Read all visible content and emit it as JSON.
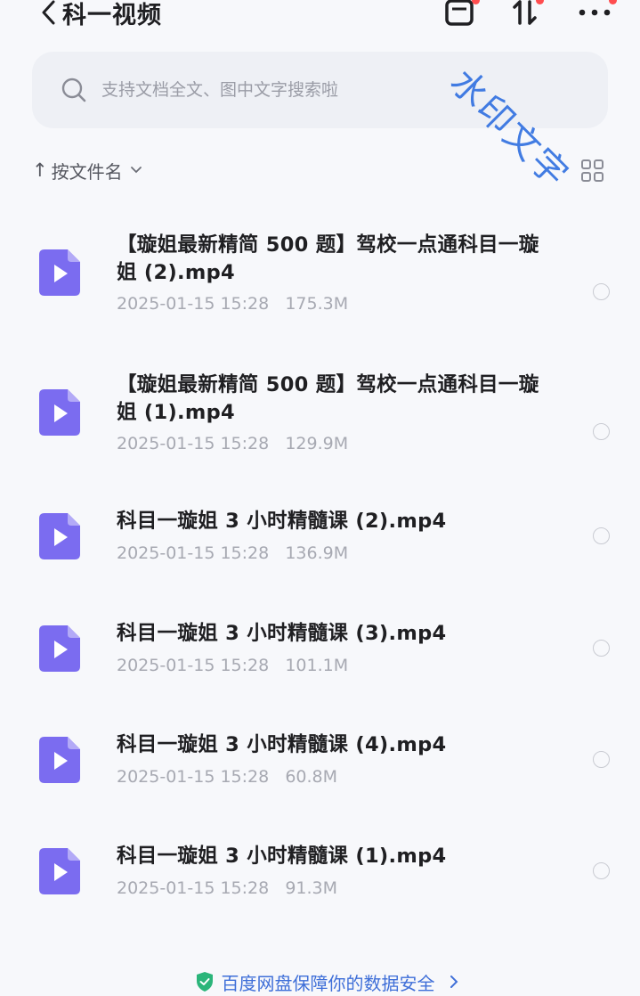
{
  "header": {
    "title": "科一视频",
    "back_icon": "chevron-left-icon",
    "actions": [
      {
        "name": "transfer-list",
        "icon": "transfer-box-icon",
        "badge": true
      },
      {
        "name": "sort-toggle",
        "icon": "sort-arrows-icon",
        "badge": true
      },
      {
        "name": "more",
        "icon": "more-dots-icon",
        "badge": false
      }
    ]
  },
  "search": {
    "placeholder": "支持文档全文、图中文字搜索啦"
  },
  "sort": {
    "arrow": "↑",
    "label": "按文件名"
  },
  "files": [
    {
      "name": "【璇姐最新精简 500 题】驾校一点通科目一璇姐 (2).mp4",
      "date": "2025-01-15 15:28",
      "size": "175.3M"
    },
    {
      "name": "【璇姐最新精简 500 题】驾校一点通科目一璇姐 (1).mp4",
      "date": "2025-01-15 15:28",
      "size": "129.9M"
    },
    {
      "name": "科目一璇姐 3 小时精髓课 (2).mp4",
      "date": "2025-01-15 15:28",
      "size": "136.9M"
    },
    {
      "name": "科目一璇姐 3 小时精髓课 (3).mp4",
      "date": "2025-01-15 15:28",
      "size": "101.1M"
    },
    {
      "name": "科目一璇姐 3 小时精髓课 (4).mp4",
      "date": "2025-01-15 15:28",
      "size": "60.8M"
    },
    {
      "name": "科目一璇姐 3 小时精髓课 (1).mp4",
      "date": "2025-01-15 15:28",
      "size": "91.3M"
    }
  ],
  "footer": {
    "text": "百度网盘保障你的数据安全",
    "icon": "shield-check-icon"
  },
  "watermark": "水印文字",
  "colors": {
    "accent": "#7b6cf0",
    "link": "#3f6fd8",
    "badge": "#ff4d4f",
    "background": "#f7f8fb"
  }
}
